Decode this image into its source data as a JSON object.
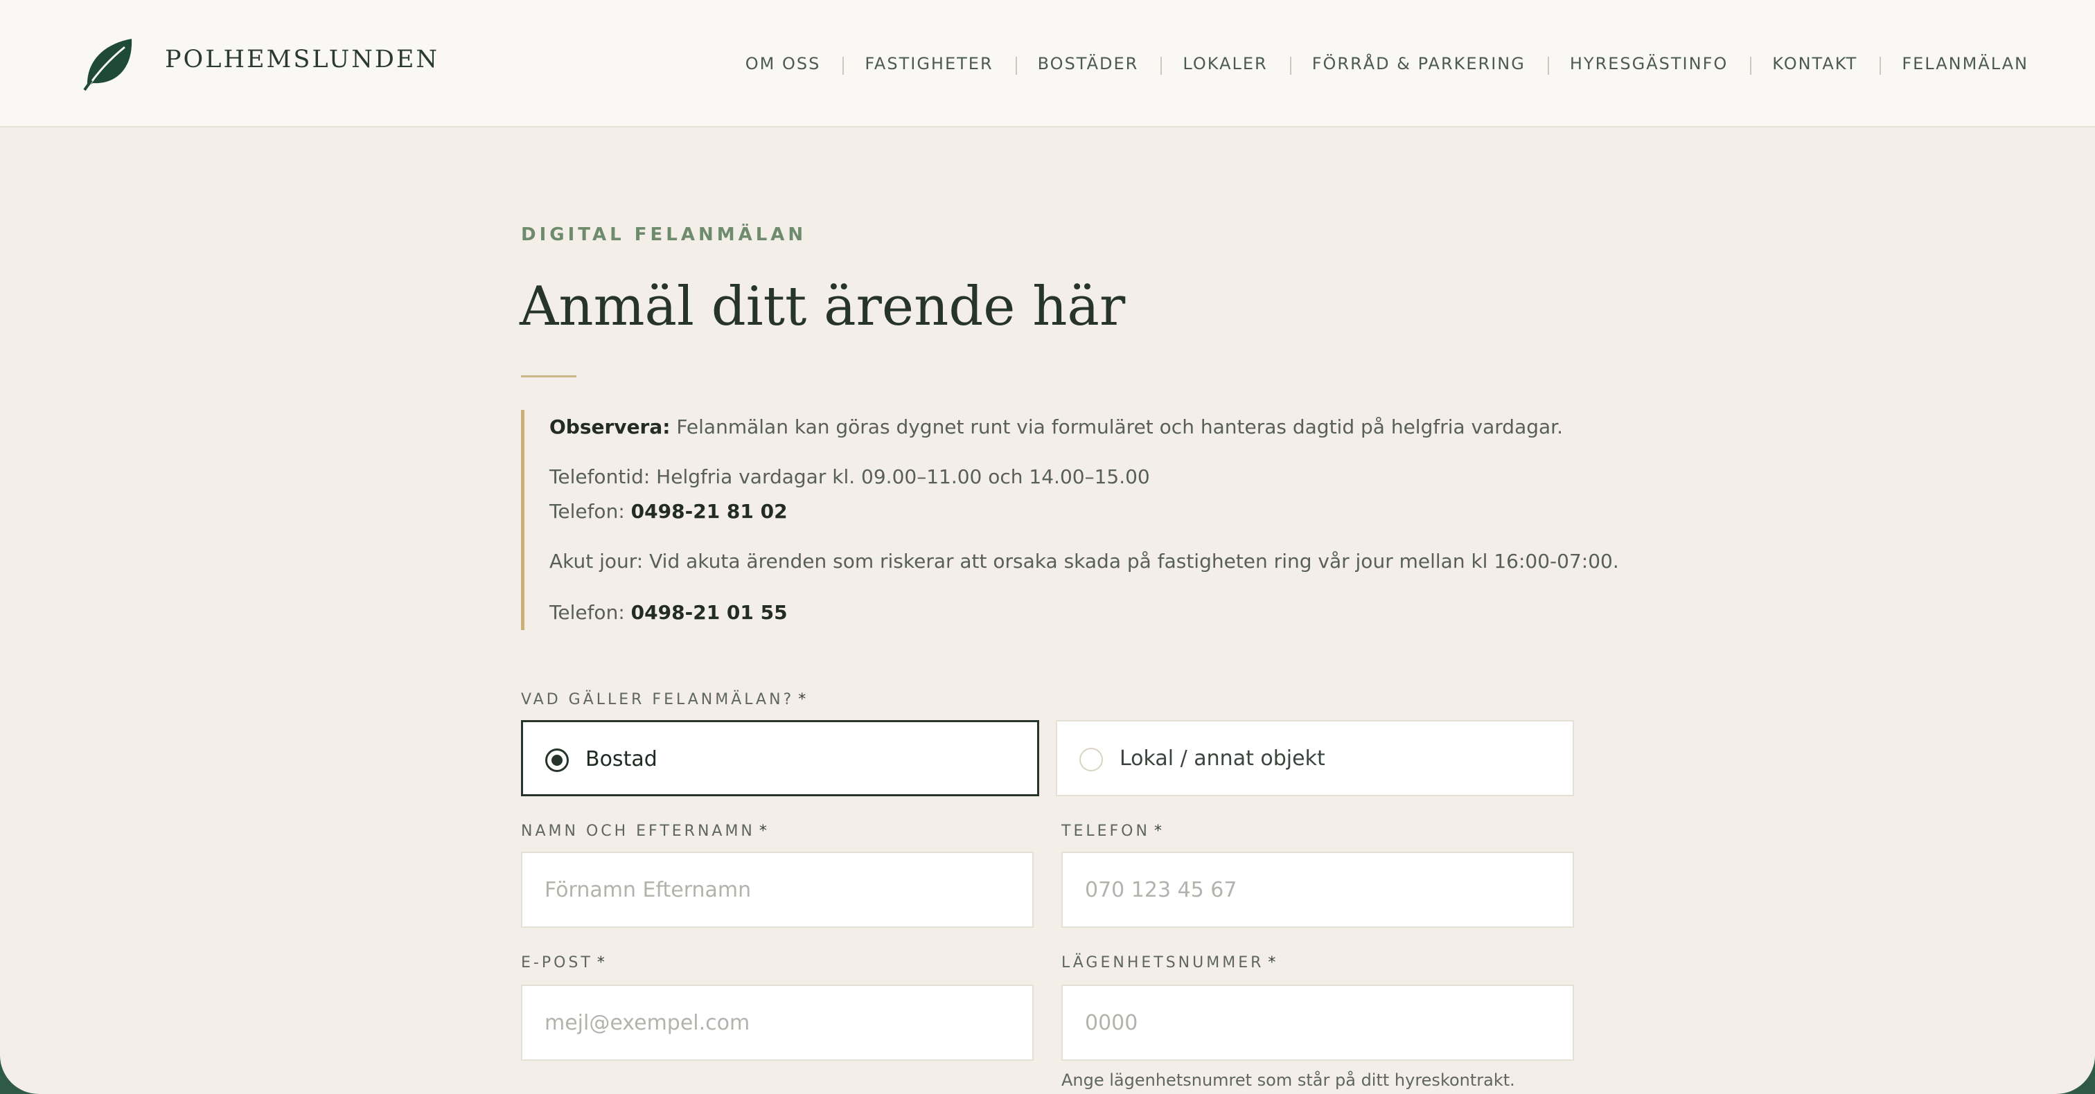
{
  "brand": {
    "name": "POLHEMSLUNDEN",
    "logo_icon": "leaf-icon",
    "accent": "#1f4a3a"
  },
  "nav": [
    {
      "label": "OM OSS"
    },
    {
      "label": "FASTIGHETER"
    },
    {
      "label": "BOSTÄDER"
    },
    {
      "label": "LOKALER"
    },
    {
      "label": "FÖRRÅD & PARKERING"
    },
    {
      "label": "HYRESGÄSTINFO"
    },
    {
      "label": "KONTAKT"
    },
    {
      "label": "FELANMÄLAN"
    }
  ],
  "page": {
    "eyebrow": "DIGITAL FELANMÄLAN",
    "title": "Anmäl ditt ärende här"
  },
  "notice": {
    "observe_label": "Observera:",
    "observe_text": " Felanmälan kan göras dygnet runt via formuläret och hanteras dagtid på helgfria vardagar.",
    "phone_hours": "Telefontid: Helgfria vardagar kl. 09.00–11.00 och 14.00–15.00",
    "phone_label": "Telefon: ",
    "phone_number": "0498-21 81 02",
    "emergency_text": "Akut jour: Vid akuta ärenden som riskerar att orsaka skada på fastigheten ring vår jour mellan kl 16:00-07:00.",
    "emergency_phone_label": "Telefon: ",
    "emergency_phone_number": "0498-21 01 55"
  },
  "form": {
    "type_label": "VAD GÄLLER FELANMÄLAN?",
    "required_mark": "*",
    "options": [
      {
        "label": "Bostad",
        "selected": true
      },
      {
        "label": "Lokal / annat objekt",
        "selected": false
      }
    ],
    "name": {
      "label": "NAMN OCH EFTERNAMN",
      "placeholder": "Förnamn Efternamn",
      "value": ""
    },
    "phone": {
      "label": "TELEFON",
      "placeholder": "070 123 45 67",
      "value": ""
    },
    "email": {
      "label": "E-POST",
      "placeholder": "mejl@exempel.com",
      "value": ""
    },
    "apartment": {
      "label": "LÄGENHETSNUMMER",
      "placeholder": "0000",
      "value": "",
      "hint": "Ange lägenhetsnumret som står på ditt hyreskontrakt."
    }
  }
}
